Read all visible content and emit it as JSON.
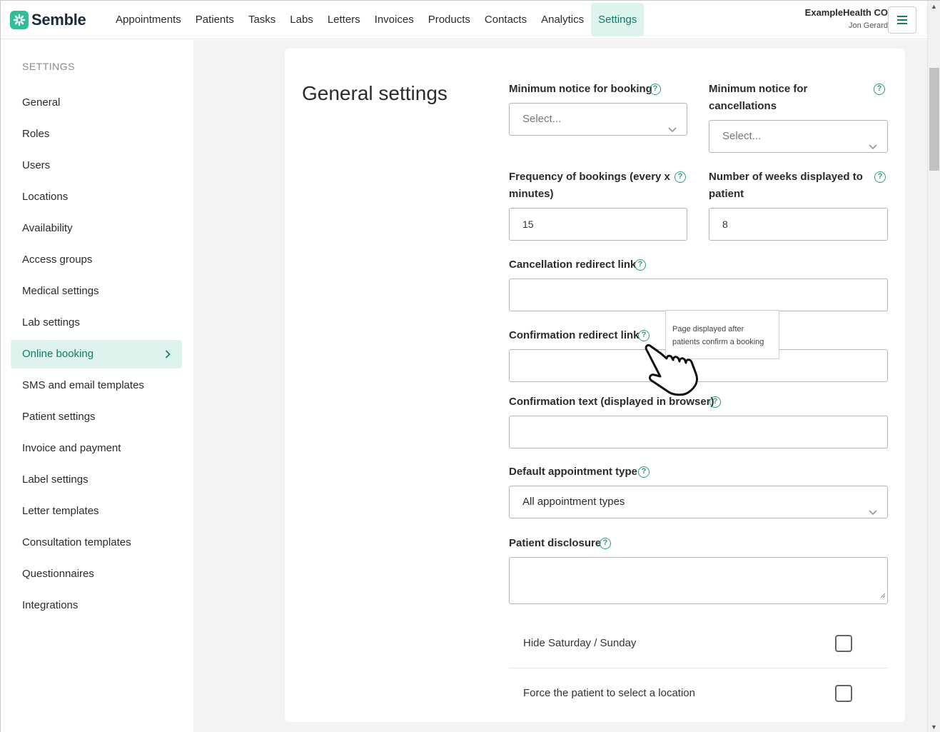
{
  "header": {
    "logo_text": "Semble",
    "nav": [
      "Appointments",
      "Patients",
      "Tasks",
      "Labs",
      "Letters",
      "Invoices",
      "Products",
      "Contacts",
      "Analytics",
      "Settings"
    ],
    "active_nav": "Settings",
    "org_name": "ExampleHealth CO",
    "user_name": "Jon Gerard"
  },
  "sidebar": {
    "heading": "SETTINGS",
    "items": [
      {
        "label": "General"
      },
      {
        "label": "Roles"
      },
      {
        "label": "Users"
      },
      {
        "label": "Locations"
      },
      {
        "label": "Availability"
      },
      {
        "label": "Access groups"
      },
      {
        "label": "Medical settings"
      },
      {
        "label": "Lab settings"
      },
      {
        "label": "Online booking"
      },
      {
        "label": "SMS and email templates"
      },
      {
        "label": "Patient settings"
      },
      {
        "label": "Invoice and payment"
      },
      {
        "label": "Label settings"
      },
      {
        "label": "Letter templates"
      },
      {
        "label": "Consultation templates"
      },
      {
        "label": "Questionnaires"
      },
      {
        "label": "Integrations"
      }
    ],
    "active_item": "Online booking"
  },
  "main": {
    "title": "General settings",
    "fields": {
      "min_notice_booking": {
        "label": "Minimum notice for booking",
        "value": "Select..."
      },
      "min_notice_cancel": {
        "label_line1": "Minimum notice for",
        "label_line2": "cancellations",
        "value": "Select..."
      },
      "frequency": {
        "label_line1": "Frequency of bookings (every x",
        "label_line2": "minutes)",
        "value": "15"
      },
      "weeks_displayed": {
        "label_line1": "Number of weeks displayed to",
        "label_line2": "patient",
        "value": "8"
      },
      "cancel_redirect": {
        "label": "Cancellation redirect link",
        "value": ""
      },
      "confirm_redirect": {
        "label": "Confirmation redirect link",
        "value": ""
      },
      "confirm_text": {
        "label": "Confirmation text (displayed in browser)",
        "value": ""
      },
      "default_appt": {
        "label": "Default appointment type",
        "value": "All appointment types"
      },
      "patient_disclosure": {
        "label": "Patient disclosure",
        "value": ""
      }
    },
    "checkboxes": [
      {
        "label": "Hide Saturday / Sunday",
        "checked": false
      },
      {
        "label": "Force the patient to select a location",
        "checked": false
      }
    ],
    "tooltip": {
      "line1": "Page displayed after",
      "line2": "patients confirm a booking"
    },
    "help_glyph": "?"
  },
  "colors": {
    "accent": "#2a9c83",
    "active_bg": "#dff3ee",
    "page_bg": "#f4f3f1"
  },
  "icons": [
    "semble-logo-icon",
    "hamburger-menu-icon",
    "chevron-right-icon",
    "chevron-down-icon",
    "help-circle-icon",
    "hand-pointer-cursor-icon"
  ]
}
